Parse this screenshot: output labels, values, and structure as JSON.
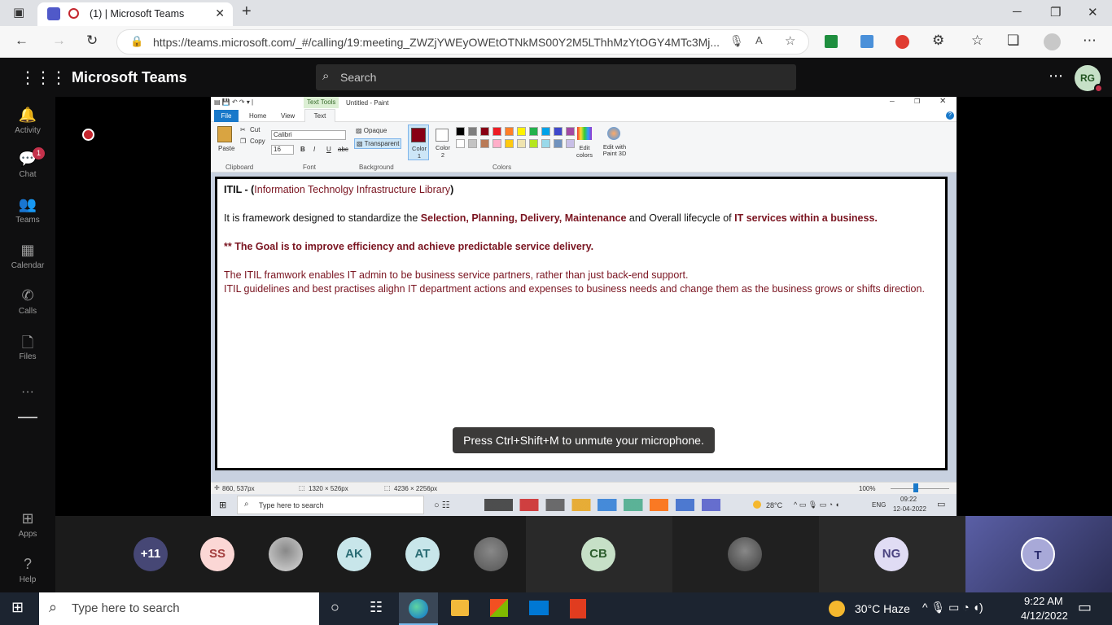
{
  "browser": {
    "tab_title": "(1) | Microsoft Teams",
    "url": "https://teams.microsoft.com/_#/calling/19:meeting_ZWZjYWEyOWEtOTNkMS00Y2M5LThhMzYtOGY4MTc3Mj..."
  },
  "teams": {
    "app_title": "Microsoft Teams",
    "search_placeholder": "Search",
    "avatar_initials": "RG",
    "chat_badge": "1",
    "rail": [
      {
        "label": "Activity",
        "icon": "bell-icon"
      },
      {
        "label": "Chat",
        "icon": "chat-icon"
      },
      {
        "label": "Teams",
        "icon": "teams-icon"
      },
      {
        "label": "Calendar",
        "icon": "calendar-icon"
      },
      {
        "label": "Calls",
        "icon": "phone-icon"
      },
      {
        "label": "Files",
        "icon": "file-icon"
      },
      {
        "label": "Apps",
        "icon": "apps-icon"
      },
      {
        "label": "Help",
        "icon": "help-icon"
      }
    ]
  },
  "paint": {
    "window_title": "Untitled - Paint",
    "context_tab": "Text Tools",
    "tabs": [
      "File",
      "Home",
      "View",
      "Text"
    ],
    "clipboard": {
      "paste": "Paste",
      "cut": "Cut",
      "copy": "Copy",
      "group": "Clipboard"
    },
    "font": {
      "name": "Calibri",
      "size": "16",
      "group": "Font"
    },
    "background": {
      "opaque": "Opaque",
      "transparent": "Transparent",
      "group": "Background"
    },
    "colors": {
      "color1": "Color 1",
      "color2": "Color 2",
      "edit": "Edit colors",
      "paint3d": "Edit with Paint 3D",
      "group": "Colors"
    },
    "status": {
      "cursor": "860, 537px",
      "selection": "1320 × 526px",
      "size": "4236 × 2256px",
      "zoom": "100%"
    },
    "taskbar": {
      "search": "Type here to search",
      "weather": "28°C",
      "lang": "ENG",
      "time": "09:22",
      "date": "12-04-2022"
    },
    "canvas_lines": [
      {
        "parts": [
          {
            "t": "ITIL - (",
            "c": "dark bold"
          },
          {
            "t": "Information Technolgy Infrastructure Library",
            "c": "maroon"
          },
          {
            "t": ")",
            "c": "dark bold"
          }
        ]
      },
      {
        "parts": [
          {
            "t": "It is framework designed to standardize the ",
            "c": "dark"
          },
          {
            "t": "Selection, Planning, Delivery, Maintenance",
            "c": "maroon bold"
          },
          {
            "t": " and Overall lifecycle of ",
            "c": "dark"
          },
          {
            "t": "IT services within a business.",
            "c": "maroon bold"
          }
        ]
      },
      {
        "parts": [
          {
            "t": "** The Goal is to improve efficiency and achieve predictable service delivery.",
            "c": "maroon bold"
          }
        ]
      },
      {
        "parts": [
          {
            "t": "The ITIL framwork enables IT admin to be business service partners, rather than just back-end support.",
            "c": "maroon"
          }
        ]
      },
      {
        "parts": [
          {
            "t": "ITIL guidelines and best practises alighn IT department actions and expenses to business needs and change them as the business grows or shifts direction.",
            "c": "maroon"
          }
        ]
      }
    ],
    "palette": [
      "#000000",
      "#7f7f7f",
      "#880015",
      "#ed1c24",
      "#ff7f27",
      "#fff200",
      "#22b14c",
      "#00a2e8",
      "#3f48cc",
      "#a349a4",
      "#ffffff",
      "#c3c3c3",
      "#b97a57",
      "#ffaec9",
      "#ffc90e",
      "#efe4b0",
      "#b5e61d",
      "#99d9ea",
      "#7092be",
      "#c8bfe7"
    ]
  },
  "toast": "Press Ctrl+Shift+M to unmute your microphone.",
  "participants": [
    {
      "initials": "+11",
      "bg": "#464775",
      "fg": "#ffffff"
    },
    {
      "initials": "SS",
      "bg": "#fbd7d5",
      "fg": "#a33d3d"
    },
    {
      "initials": "",
      "bg": "#d9d9d9",
      "fg": "#333333",
      "photo": true
    },
    {
      "initials": "AK",
      "bg": "#c8e6ea",
      "fg": "#2a6c74"
    },
    {
      "initials": "AT",
      "bg": "#c8e6ea",
      "fg": "#2a6c74"
    },
    {
      "initials": "",
      "bg": "#555555",
      "fg": "#ffffff",
      "photo": true
    },
    {
      "initials": "CB",
      "bg": "#c6e0c7",
      "fg": "#2d5e2e"
    },
    {
      "initials": "",
      "bg": "#3d3d3d",
      "fg": "#ffffff",
      "photo": true
    },
    {
      "initials": "NG",
      "bg": "#e0dcf4",
      "fg": "#4a4380"
    },
    {
      "initials": "T",
      "bg": "#a8a9d8",
      "fg": "#2b2d6e"
    }
  ],
  "windows": {
    "search_placeholder": "Type here to search",
    "weather": "30°C  Haze",
    "time": "9:22 AM",
    "date": "4/12/2022"
  }
}
